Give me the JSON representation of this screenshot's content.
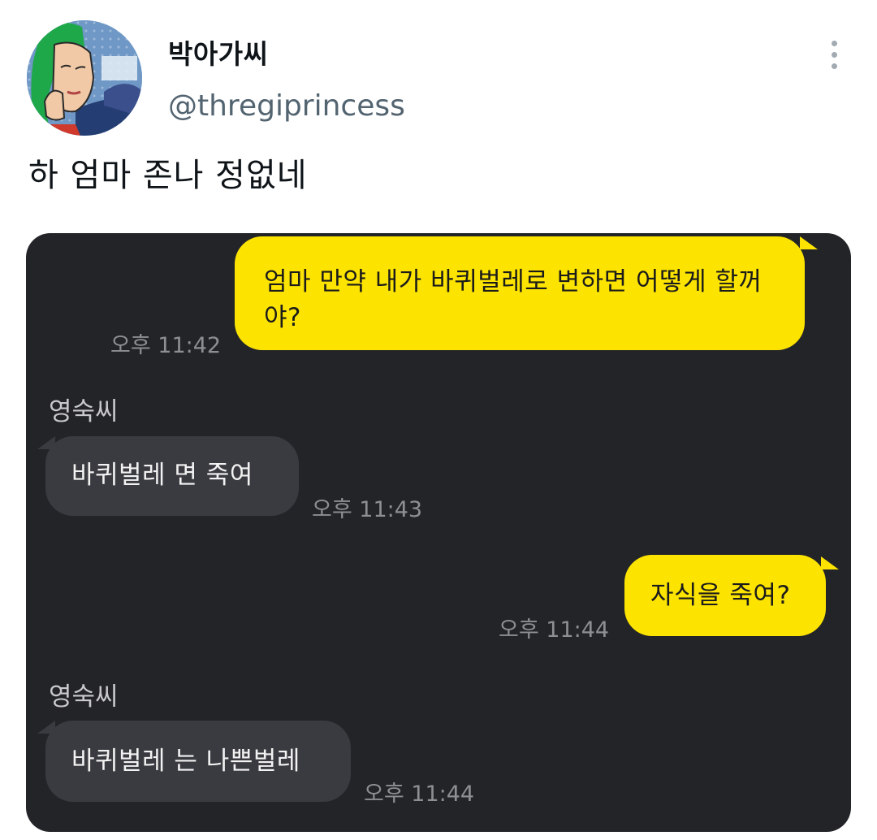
{
  "tweet": {
    "display_name": "박아가씨",
    "handle": "@thregiprincess",
    "text": "하 엄마 존나 정없네",
    "more_icon": "three-dots-vertical-icon"
  },
  "chat": {
    "messages": [
      {
        "direction": "out",
        "text_line1": "엄마 만약 내가 바퀴벌레로 변하면 어떻게 할꺼",
        "text_line2": "야?",
        "time": "오후 11:42"
      },
      {
        "direction": "in",
        "sender": "영숙씨",
        "text": "바퀴벌레 면 죽여",
        "time": "오후 11:43"
      },
      {
        "direction": "out",
        "text": "자식을 죽여?",
        "time": "오후 11:44"
      },
      {
        "direction": "in",
        "sender": "영숙씨",
        "text": "바퀴벌레 는 나쁜벌레",
        "time": "오후 11:44"
      }
    ],
    "colors": {
      "background": "#232428",
      "outgoing_bubble": "#fde400",
      "incoming_bubble": "#3a3b40"
    }
  }
}
